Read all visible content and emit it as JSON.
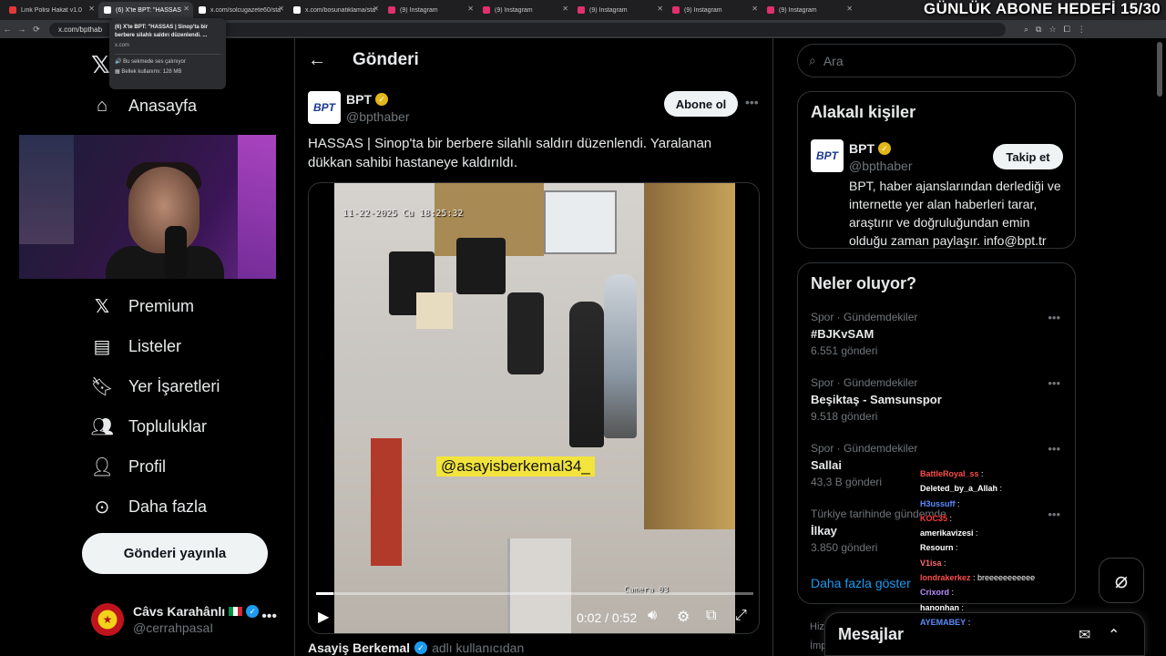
{
  "overlay_goal": "GÜNLÜK ABONE HEDEFİ 15/30",
  "browser": {
    "tabs": [
      {
        "title": "Link Polisi Hakat v1.0",
        "color": "#e53935"
      },
      {
        "title": "(6) X'te BPT: \"HASSAS",
        "color": "#ffffff"
      },
      {
        "title": "x.com/solcugazete60/sta",
        "color": "#ffffff"
      },
      {
        "title": "x.com/bosunatiklama/sta",
        "color": "#ffffff"
      },
      {
        "title": "(9) Instagram",
        "color": "#e1306c"
      },
      {
        "title": "(9) Instagram",
        "color": "#e1306c"
      },
      {
        "title": "(9) Instagram",
        "color": "#e1306c"
      },
      {
        "title": "(9) Instagram",
        "color": "#e1306c"
      },
      {
        "title": "(9) Instagram",
        "color": "#e1306c"
      }
    ],
    "url": "x.com/bpthab",
    "hover_card": {
      "title": "(6) X'te BPT: \"HASSAS | Sinop'ta bir berbere silahlı saldırı düzenlendi. ...",
      "url": "x.com",
      "audio": "Bu sekmede ses çalınıyor",
      "memory": "Bellek kullanımı: 128 MB"
    }
  },
  "sidebar": {
    "logo": "𝕏",
    "items": [
      {
        "label": "Anasayfa",
        "icon": "home-icon"
      },
      {
        "label": "Premium",
        "icon": "x-premium-icon"
      },
      {
        "label": "Listeler",
        "icon": "list-icon"
      },
      {
        "label": "Yer İşaretleri",
        "icon": "bookmark-icon"
      },
      {
        "label": "Topluluklar",
        "icon": "communities-icon"
      },
      {
        "label": "Profil",
        "icon": "profile-icon"
      },
      {
        "label": "Daha fazla",
        "icon": "more-circle-icon"
      }
    ],
    "post_button": "Gönderi yayınla",
    "account": {
      "name": "Câvs Karahânlı",
      "handle": "@cerrahpasaI"
    }
  },
  "main": {
    "title": "Gönderi",
    "tweet": {
      "name": "BPT",
      "handle": "@bpthaber",
      "avatar_text": "BPT",
      "follow": "Abone ol",
      "text": "HASSAS | Sinop'ta bir berbere silahlı saldırı düzenlendi. Yaralanan dükkan sahibi hastaneye kaldırıldı.",
      "video": {
        "timestamp": "11-22-2025 Cu 18:25:32",
        "watermark": "@asayisberkemal34_",
        "camera": "Camera 03",
        "time": "0:02 / 0:52",
        "progress": 0.04
      },
      "attribution_name": "Asayiş Berkemal",
      "attribution_suffix": "adlı kullanıcıdan"
    }
  },
  "right": {
    "search_placeholder": "Ara",
    "related": {
      "title": "Alakalı kişiler",
      "name": "BPT",
      "handle": "@bpthaber",
      "follow": "Takip et",
      "bio": "BPT, haber ajanslarından derlediği ve internette yer alan haberleri tarar, araştırır ve doğruluğundan emin olduğu zaman paylaşır. info@bpt.tr"
    },
    "trends": {
      "title": "Neler oluyor?",
      "items": [
        {
          "category": "Spor · Gündemdekiler",
          "name": "#BJKvSAM",
          "count": "6.551 gönderi"
        },
        {
          "category": "Spor · Gündemdekiler",
          "name": "Beşiktaş - Samsunspor",
          "count": "9.518 gönderi"
        },
        {
          "category": "Spor · Gündemdekiler",
          "name": "Sallai",
          "count": "43,3 B gönderi"
        },
        {
          "category": "Türkiye tarihinde gündemde",
          "name": "İlkay",
          "count": "3.850 gönderi"
        }
      ],
      "show_more": "Daha fazla göster"
    },
    "messages": "Mesajlar",
    "footer_1": "Hizm",
    "footer_2": "İmp"
  },
  "chat": [
    {
      "user": "",
      "msg": "",
      "color": "#ffffff"
    },
    {
      "user": "BattleRoyal_ss",
      "msg": "",
      "color": "#ff4d4d"
    },
    {
      "user": "Deleted_by_a_Allah",
      "msg": "",
      "color": "#ffffff"
    },
    {
      "user": "H3ussuff",
      "msg": "",
      "color": "#5b8cff"
    },
    {
      "user": "KOC35",
      "msg": "",
      "color": "#ff3b3b"
    },
    {
      "user": "amerikavizesi",
      "msg": "",
      "color": "#ffffff"
    },
    {
      "user": "Resourn",
      "msg": "",
      "color": "#ffffff"
    },
    {
      "user": "V1isa",
      "msg": "",
      "color": "#ff6a6a"
    },
    {
      "user": "londrakerkez",
      "msg": "breeeeeeeeeee",
      "color": "#ff4d4d"
    },
    {
      "user": "Crixord",
      "msg": "",
      "color": "#b98cff"
    },
    {
      "user": "hanonhan",
      "msg": "",
      "color": "#ffffff"
    },
    {
      "user": "AYEMABEY",
      "msg": "",
      "color": "#5b8cff"
    }
  ]
}
